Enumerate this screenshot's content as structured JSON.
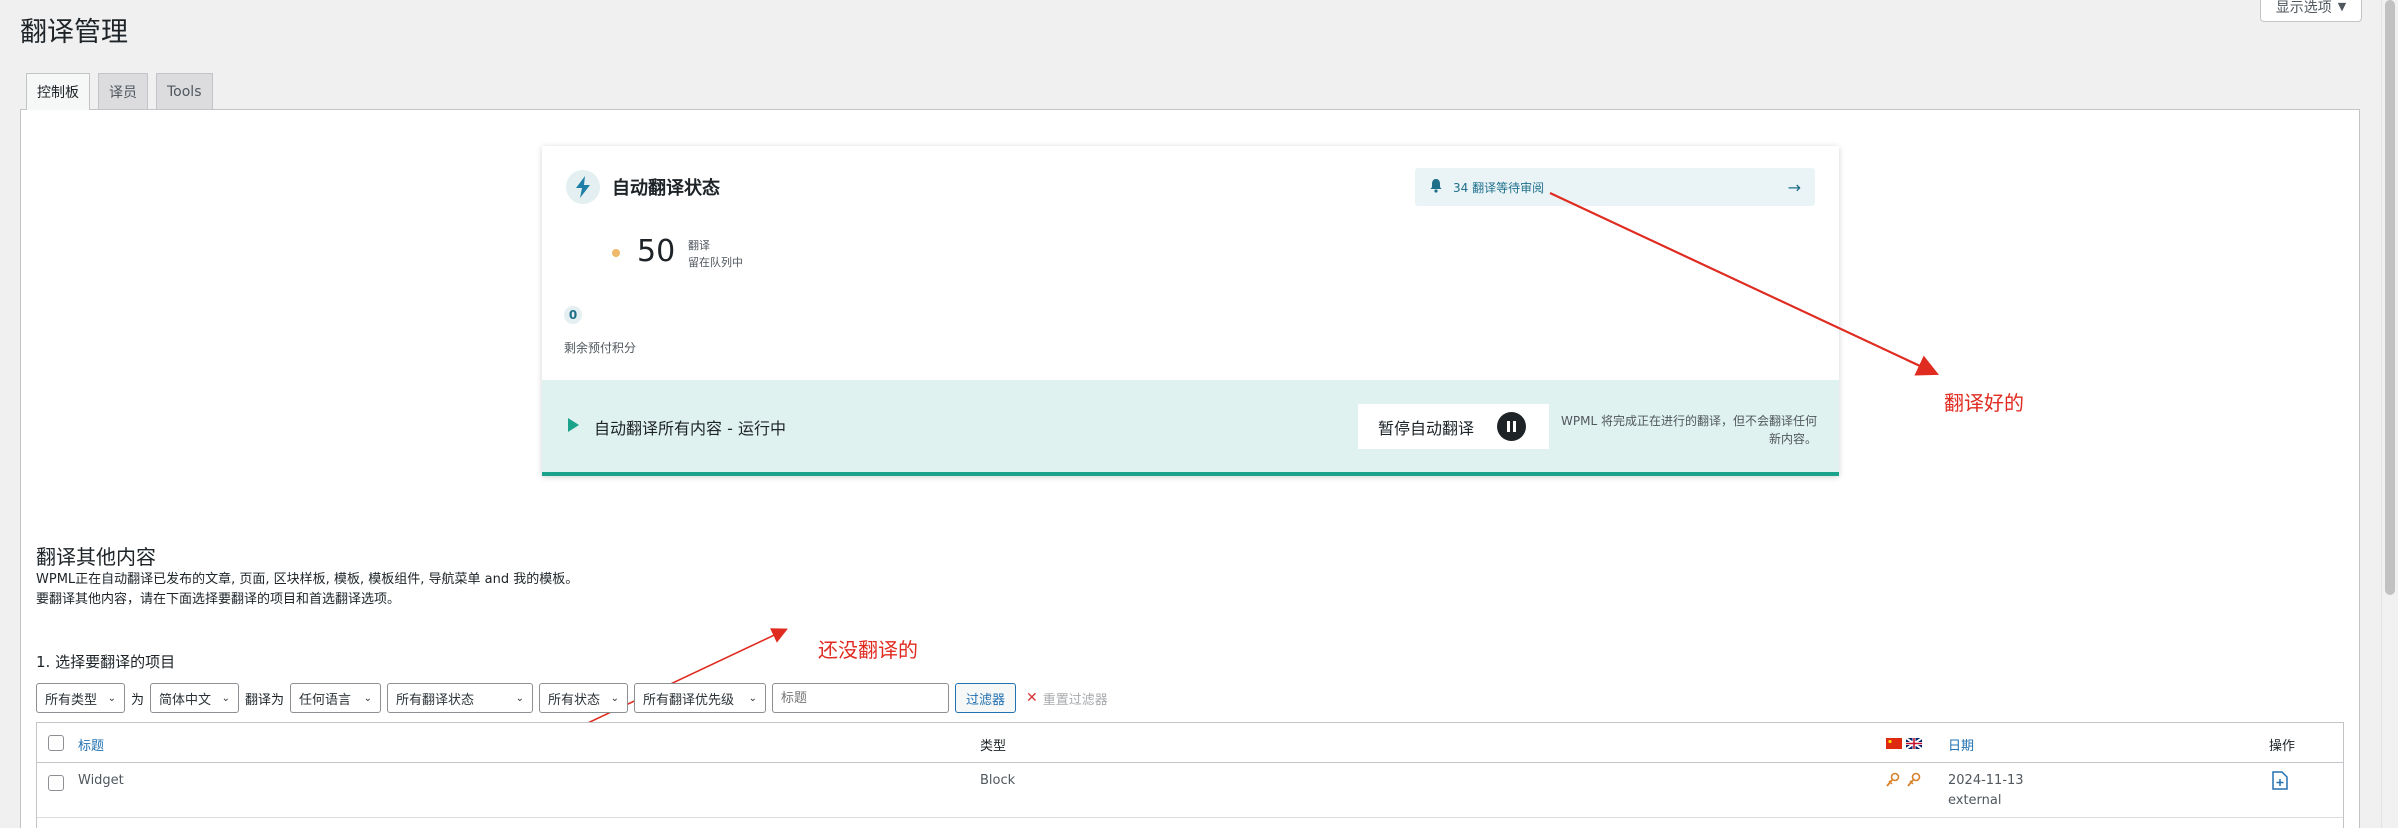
{
  "page": {
    "title": "翻译管理",
    "screen_options": "显示选项"
  },
  "tabs": [
    {
      "label": "控制板",
      "active": true
    },
    {
      "label": "译员",
      "active": false
    },
    {
      "label": "Tools",
      "active": false
    }
  ],
  "auto_card": {
    "title": "自动翻译状态",
    "icon": "lightning-icon",
    "notification": "34 翻译等待审阅",
    "count": "50",
    "count_label_1": "翻译",
    "count_label_2": "留在队列中",
    "credits": "0",
    "credits_label": "剩余预付积分",
    "status_text": "自动翻译所有内容 - 运行中",
    "pause_label": "暂停自动翻译",
    "pause_note_1": "WPML 将完成正在进行的翻译，但不会翻译任何",
    "pause_note_2": "新内容。",
    "accent": "#1aa38a"
  },
  "annotations": {
    "translated": "翻译好的",
    "untranslated": "还没翻译的",
    "color": "#e02b20"
  },
  "other": {
    "title": "翻译其他内容",
    "desc_1": "WPML正在自动翻译已发布的文章, 页面, 区块样板, 模板, 模板组件, 导航菜单 and 我的模板。",
    "desc_2": "要翻译其他内容，请在下面选择要翻译的项目和首选翻译选项。",
    "step": "1. 选择要翻译的项目"
  },
  "filters": {
    "type": "所有类型",
    "for_word": "为",
    "source_lang": "简体中文",
    "translate_to_word": "翻译为",
    "target_lang": "任何语言",
    "translation_status": "所有翻译状态",
    "status": "所有状态",
    "priority": "所有翻译优先级",
    "title_placeholder": "标题",
    "filter_button": "过滤器",
    "reset": "重置过滤器"
  },
  "table": {
    "headers": {
      "title": "标题",
      "type": "类型",
      "date": "日期",
      "actions": "操作"
    },
    "rows": [
      {
        "title": "Widget",
        "type": "Block",
        "date": "2024-11-13",
        "source": "external"
      }
    ]
  }
}
